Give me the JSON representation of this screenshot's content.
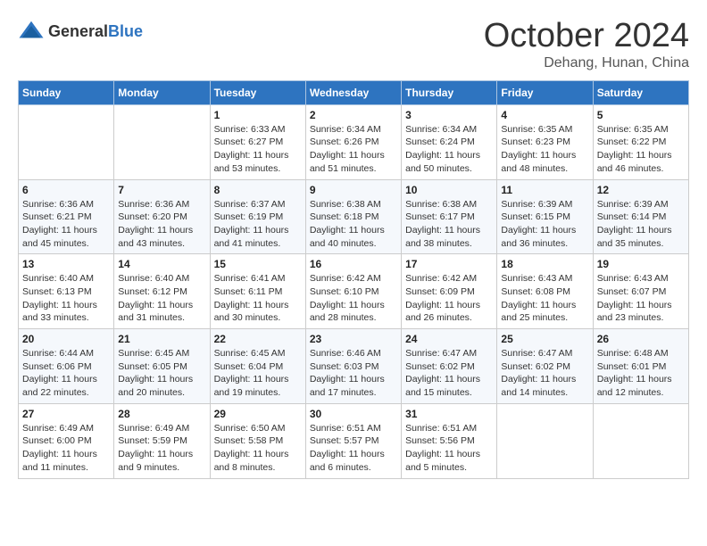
{
  "header": {
    "logo_general": "General",
    "logo_blue": "Blue",
    "month": "October 2024",
    "location": "Dehang, Hunan, China"
  },
  "weekdays": [
    "Sunday",
    "Monday",
    "Tuesday",
    "Wednesday",
    "Thursday",
    "Friday",
    "Saturday"
  ],
  "weeks": [
    [
      {
        "day": "",
        "sunrise": "",
        "sunset": "",
        "daylight": ""
      },
      {
        "day": "",
        "sunrise": "",
        "sunset": "",
        "daylight": ""
      },
      {
        "day": "1",
        "sunrise": "Sunrise: 6:33 AM",
        "sunset": "Sunset: 6:27 PM",
        "daylight": "Daylight: 11 hours and 53 minutes."
      },
      {
        "day": "2",
        "sunrise": "Sunrise: 6:34 AM",
        "sunset": "Sunset: 6:26 PM",
        "daylight": "Daylight: 11 hours and 51 minutes."
      },
      {
        "day": "3",
        "sunrise": "Sunrise: 6:34 AM",
        "sunset": "Sunset: 6:24 PM",
        "daylight": "Daylight: 11 hours and 50 minutes."
      },
      {
        "day": "4",
        "sunrise": "Sunrise: 6:35 AM",
        "sunset": "Sunset: 6:23 PM",
        "daylight": "Daylight: 11 hours and 48 minutes."
      },
      {
        "day": "5",
        "sunrise": "Sunrise: 6:35 AM",
        "sunset": "Sunset: 6:22 PM",
        "daylight": "Daylight: 11 hours and 46 minutes."
      }
    ],
    [
      {
        "day": "6",
        "sunrise": "Sunrise: 6:36 AM",
        "sunset": "Sunset: 6:21 PM",
        "daylight": "Daylight: 11 hours and 45 minutes."
      },
      {
        "day": "7",
        "sunrise": "Sunrise: 6:36 AM",
        "sunset": "Sunset: 6:20 PM",
        "daylight": "Daylight: 11 hours and 43 minutes."
      },
      {
        "day": "8",
        "sunrise": "Sunrise: 6:37 AM",
        "sunset": "Sunset: 6:19 PM",
        "daylight": "Daylight: 11 hours and 41 minutes."
      },
      {
        "day": "9",
        "sunrise": "Sunrise: 6:38 AM",
        "sunset": "Sunset: 6:18 PM",
        "daylight": "Daylight: 11 hours and 40 minutes."
      },
      {
        "day": "10",
        "sunrise": "Sunrise: 6:38 AM",
        "sunset": "Sunset: 6:17 PM",
        "daylight": "Daylight: 11 hours and 38 minutes."
      },
      {
        "day": "11",
        "sunrise": "Sunrise: 6:39 AM",
        "sunset": "Sunset: 6:15 PM",
        "daylight": "Daylight: 11 hours and 36 minutes."
      },
      {
        "day": "12",
        "sunrise": "Sunrise: 6:39 AM",
        "sunset": "Sunset: 6:14 PM",
        "daylight": "Daylight: 11 hours and 35 minutes."
      }
    ],
    [
      {
        "day": "13",
        "sunrise": "Sunrise: 6:40 AM",
        "sunset": "Sunset: 6:13 PM",
        "daylight": "Daylight: 11 hours and 33 minutes."
      },
      {
        "day": "14",
        "sunrise": "Sunrise: 6:40 AM",
        "sunset": "Sunset: 6:12 PM",
        "daylight": "Daylight: 11 hours and 31 minutes."
      },
      {
        "day": "15",
        "sunrise": "Sunrise: 6:41 AM",
        "sunset": "Sunset: 6:11 PM",
        "daylight": "Daylight: 11 hours and 30 minutes."
      },
      {
        "day": "16",
        "sunrise": "Sunrise: 6:42 AM",
        "sunset": "Sunset: 6:10 PM",
        "daylight": "Daylight: 11 hours and 28 minutes."
      },
      {
        "day": "17",
        "sunrise": "Sunrise: 6:42 AM",
        "sunset": "Sunset: 6:09 PM",
        "daylight": "Daylight: 11 hours and 26 minutes."
      },
      {
        "day": "18",
        "sunrise": "Sunrise: 6:43 AM",
        "sunset": "Sunset: 6:08 PM",
        "daylight": "Daylight: 11 hours and 25 minutes."
      },
      {
        "day": "19",
        "sunrise": "Sunrise: 6:43 AM",
        "sunset": "Sunset: 6:07 PM",
        "daylight": "Daylight: 11 hours and 23 minutes."
      }
    ],
    [
      {
        "day": "20",
        "sunrise": "Sunrise: 6:44 AM",
        "sunset": "Sunset: 6:06 PM",
        "daylight": "Daylight: 11 hours and 22 minutes."
      },
      {
        "day": "21",
        "sunrise": "Sunrise: 6:45 AM",
        "sunset": "Sunset: 6:05 PM",
        "daylight": "Daylight: 11 hours and 20 minutes."
      },
      {
        "day": "22",
        "sunrise": "Sunrise: 6:45 AM",
        "sunset": "Sunset: 6:04 PM",
        "daylight": "Daylight: 11 hours and 19 minutes."
      },
      {
        "day": "23",
        "sunrise": "Sunrise: 6:46 AM",
        "sunset": "Sunset: 6:03 PM",
        "daylight": "Daylight: 11 hours and 17 minutes."
      },
      {
        "day": "24",
        "sunrise": "Sunrise: 6:47 AM",
        "sunset": "Sunset: 6:02 PM",
        "daylight": "Daylight: 11 hours and 15 minutes."
      },
      {
        "day": "25",
        "sunrise": "Sunrise: 6:47 AM",
        "sunset": "Sunset: 6:02 PM",
        "daylight": "Daylight: 11 hours and 14 minutes."
      },
      {
        "day": "26",
        "sunrise": "Sunrise: 6:48 AM",
        "sunset": "Sunset: 6:01 PM",
        "daylight": "Daylight: 11 hours and 12 minutes."
      }
    ],
    [
      {
        "day": "27",
        "sunrise": "Sunrise: 6:49 AM",
        "sunset": "Sunset: 6:00 PM",
        "daylight": "Daylight: 11 hours and 11 minutes."
      },
      {
        "day": "28",
        "sunrise": "Sunrise: 6:49 AM",
        "sunset": "Sunset: 5:59 PM",
        "daylight": "Daylight: 11 hours and 9 minutes."
      },
      {
        "day": "29",
        "sunrise": "Sunrise: 6:50 AM",
        "sunset": "Sunset: 5:58 PM",
        "daylight": "Daylight: 11 hours and 8 minutes."
      },
      {
        "day": "30",
        "sunrise": "Sunrise: 6:51 AM",
        "sunset": "Sunset: 5:57 PM",
        "daylight": "Daylight: 11 hours and 6 minutes."
      },
      {
        "day": "31",
        "sunrise": "Sunrise: 6:51 AM",
        "sunset": "Sunset: 5:56 PM",
        "daylight": "Daylight: 11 hours and 5 minutes."
      },
      {
        "day": "",
        "sunrise": "",
        "sunset": "",
        "daylight": ""
      },
      {
        "day": "",
        "sunrise": "",
        "sunset": "",
        "daylight": ""
      }
    ]
  ]
}
